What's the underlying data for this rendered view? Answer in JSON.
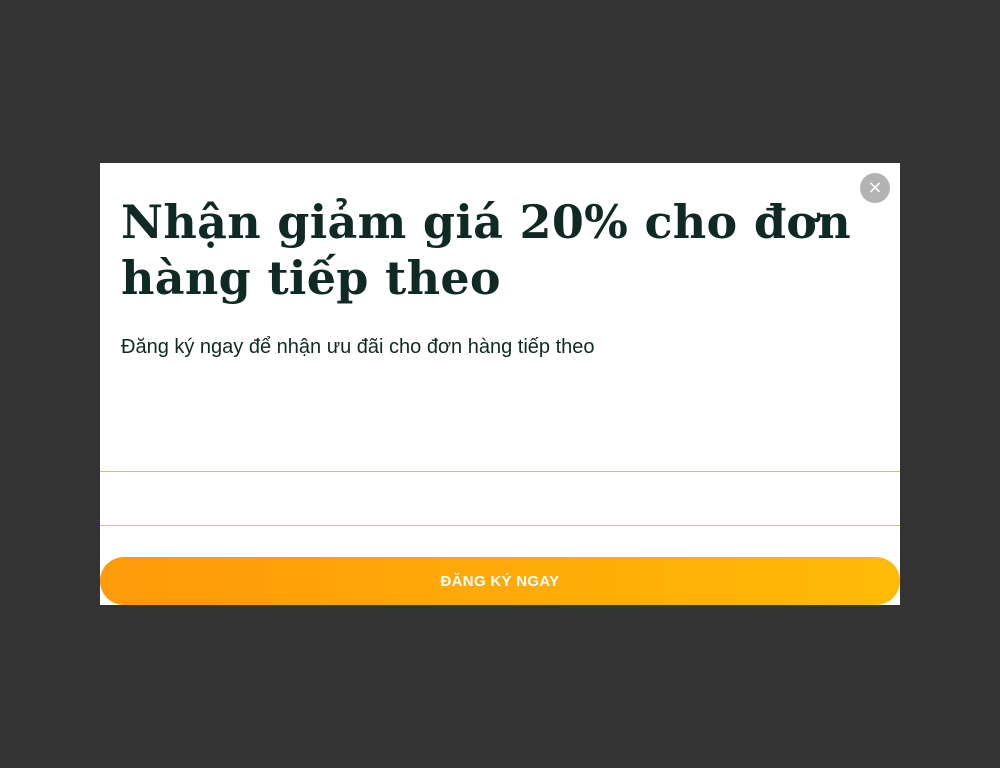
{
  "popup": {
    "title": "Nhận giảm giá 20% cho đơn hàng tiếp theo",
    "subtitle": "Đăng ký ngay để nhận ưu đãi cho đơn hàng tiếp theo",
    "email_value": "",
    "email_placeholder": "",
    "submit_label": "ĐĂNG KÝ NGAY",
    "close_glyph": "×",
    "close_icon": "close-icon"
  },
  "colors": {
    "overlay": "#333333",
    "modal_bg": "#ffffff",
    "title_text": "#0f2a24",
    "input_border": "#d6c84a",
    "button_gradient_start": "#ff9a0a",
    "button_gradient_end": "#ffba07",
    "close_bg": "#b3b3b3"
  }
}
